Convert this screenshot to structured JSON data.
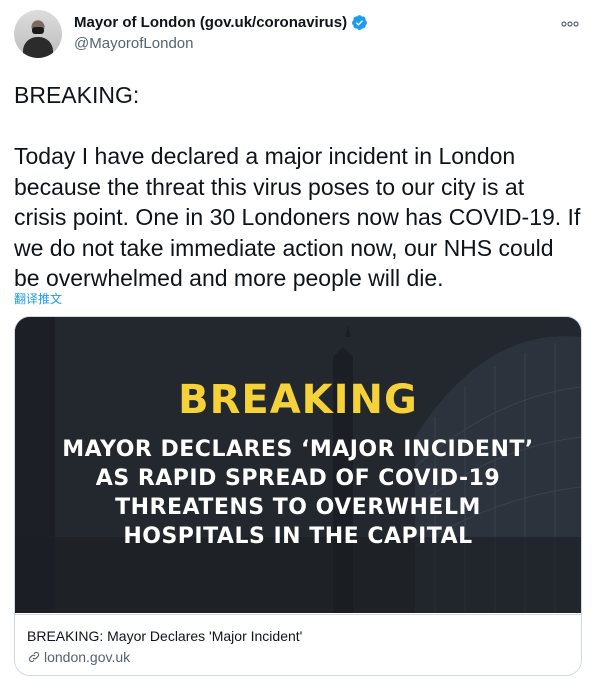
{
  "author": {
    "display_name": "Mayor of London (gov.uk/coronavirus)",
    "handle": "@MayorofLondon",
    "verified_icon": "verified-badge-icon"
  },
  "tweet": {
    "text": "BREAKING:\n\nToday I have declared a major incident in London because the threat this virus poses to our city is at crisis point. One in 30 Londoners now has COVID-19. If we do not take immediate action now, our NHS could be overwhelmed and more people will die.",
    "translate_label": "翻译推文"
  },
  "card": {
    "image_headline": "BREAKING",
    "image_subhead": "MAYOR DECLARES ‘MAJOR INCIDENT’\nAS RAPID SPREAD OF COVID-19\nTHREATENS TO OVERWHELM\nHOSPITALS IN THE CAPITAL",
    "title": "BREAKING: Mayor Declares 'Major Incident'",
    "domain": "london.gov.uk"
  },
  "colors": {
    "accent": "#1d9bf0",
    "headline_yellow": "#f5d13a",
    "card_background": "#22272e"
  }
}
